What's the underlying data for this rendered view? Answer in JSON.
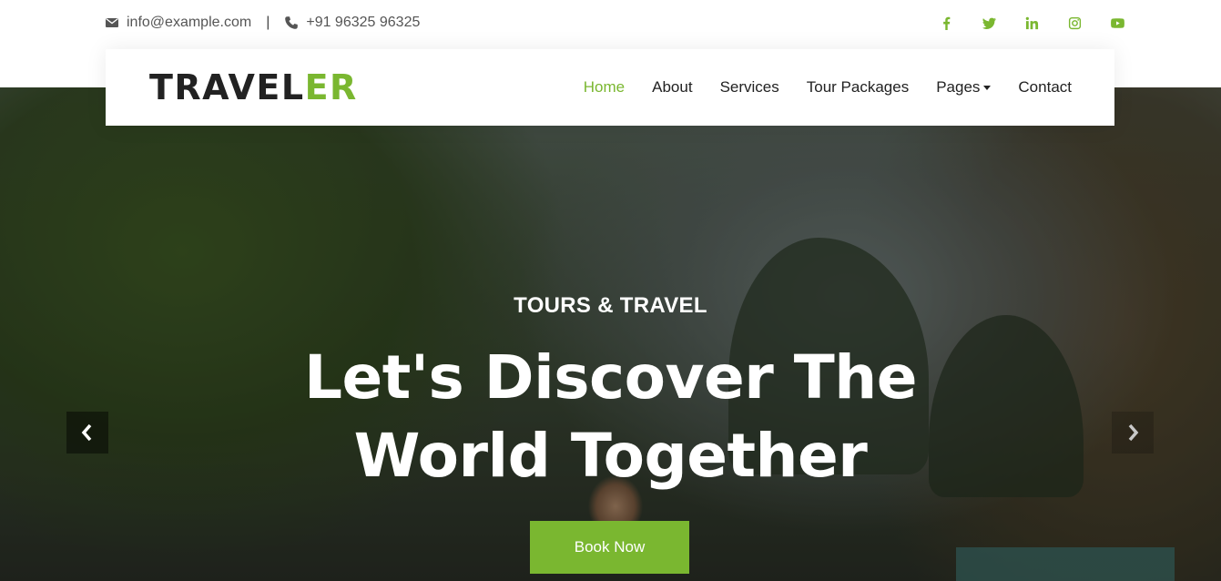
{
  "topbar": {
    "email": "info@example.com",
    "separator": "|",
    "phone": "+91 96325 96325",
    "icons": {
      "email": "envelope-icon",
      "phone": "phone-icon"
    },
    "socials": [
      "facebook-icon",
      "twitter-icon",
      "linkedin-icon",
      "instagram-icon",
      "youtube-icon"
    ]
  },
  "navbar": {
    "logo_main": "TRAVEL",
    "logo_accent": "ER",
    "items": [
      {
        "label": "Home",
        "active": true
      },
      {
        "label": "About"
      },
      {
        "label": "Services"
      },
      {
        "label": "Tour Packages"
      },
      {
        "label": "Pages",
        "dropdown": true
      },
      {
        "label": "Contact"
      }
    ]
  },
  "hero": {
    "subtitle": "TOURS & TRAVEL",
    "title_line1": "Let's Discover The",
    "title_line2": "World Together",
    "cta_label": "Book Now",
    "prev_icon": "chevron-left-icon",
    "next_icon": "chevron-right-icon"
  },
  "colors": {
    "accent": "#7ab730",
    "text_dark": "#222222",
    "text_muted": "#555555"
  }
}
